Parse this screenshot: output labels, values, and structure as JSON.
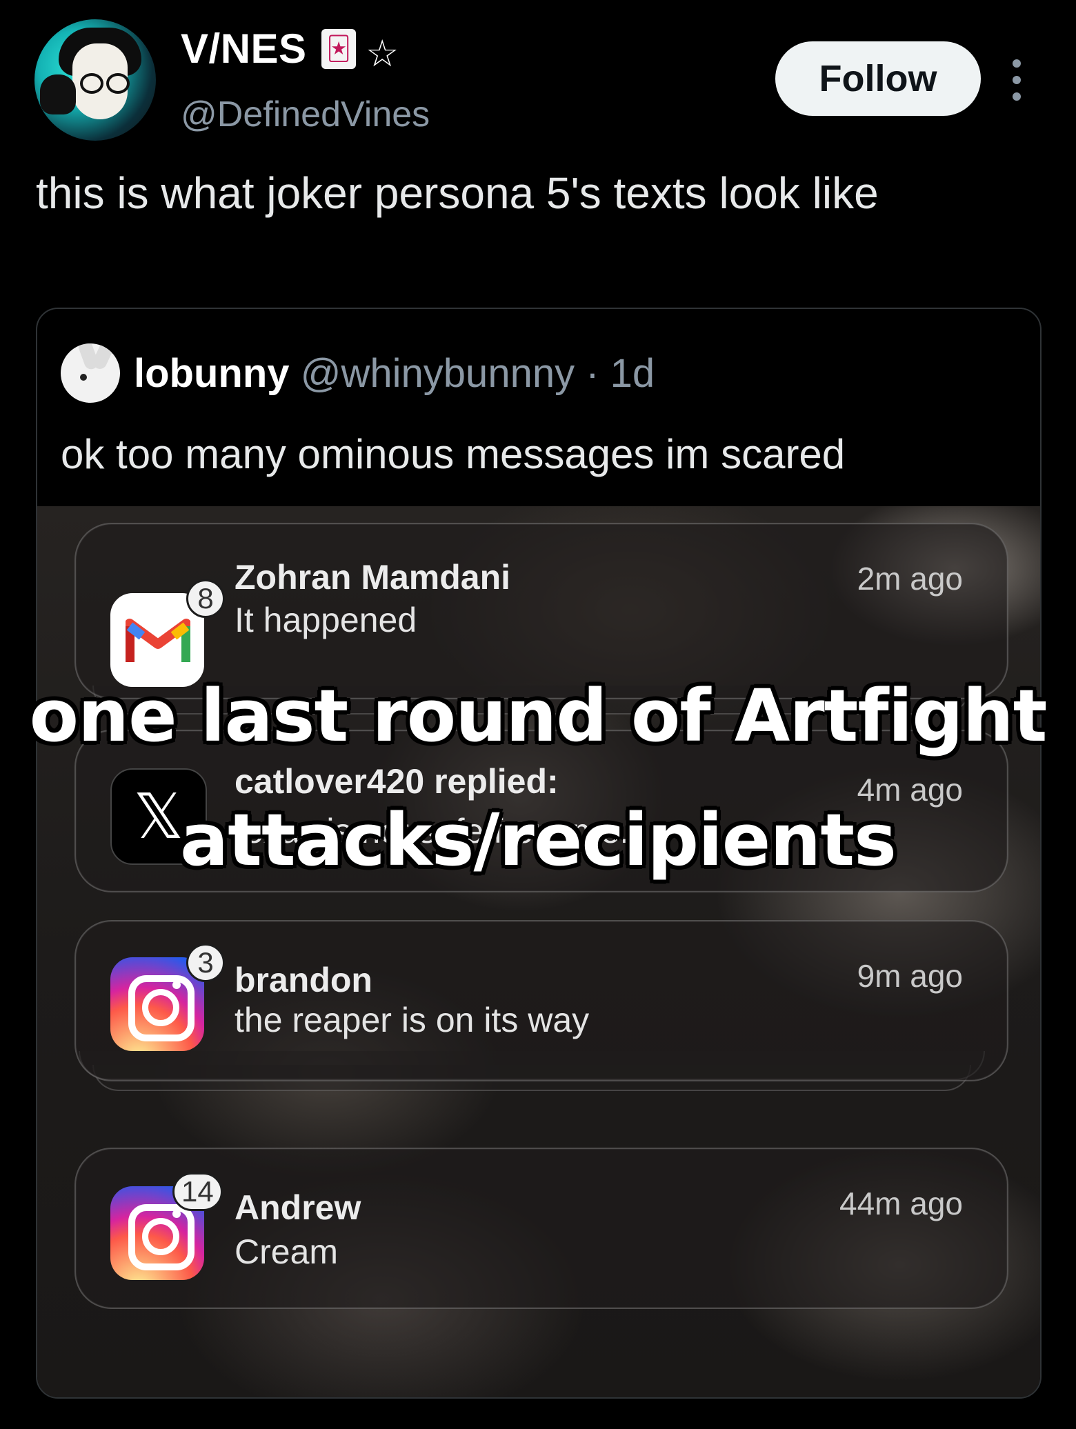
{
  "author": {
    "display_name": "V/NES",
    "name_emoji": "🃏",
    "name_star": "☆",
    "handle": "@DefinedVines",
    "avatar_icon": "anime-avatar"
  },
  "follow_label": "Follow",
  "more_icon": "more-options-icon",
  "post_text": "this is what joker persona 5's texts look like",
  "quoted": {
    "display_name": "lobunny",
    "handle": "@whinybunnny",
    "separator": "·",
    "time": "1d",
    "text": "ok too many ominous messages im scared"
  },
  "notifications": [
    {
      "app": "gmail-icon",
      "badge": "8",
      "title": "Zohran Mamdani",
      "body": "It happened",
      "time": "2m ago"
    },
    {
      "app": "x-icon",
      "badge": "",
      "title": "catlover420 replied:",
      "body": "texas is not safe from me.",
      "time": "4m ago"
    },
    {
      "app": "instagram-icon",
      "badge": "3",
      "title": "brandon",
      "body": "the reaper is on its way",
      "time": "9m ago"
    },
    {
      "app": "instagram-icon",
      "badge": "14",
      "title": "Andrew",
      "body": "Cream",
      "time": "44m ago"
    }
  ],
  "overlay_caption": {
    "line1": "one last round of Artfight",
    "line2": "attacks/recipients"
  },
  "colors": {
    "background": "#000000",
    "follow_button": "#eff3f4",
    "secondary_text": "#8b98a5"
  }
}
